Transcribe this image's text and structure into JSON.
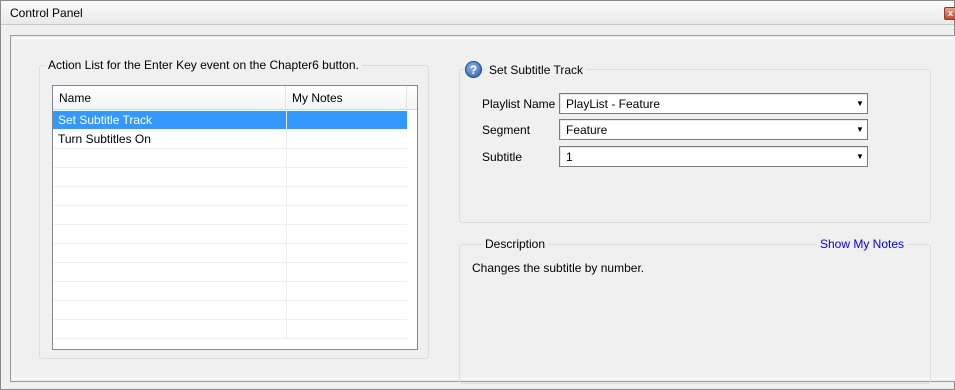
{
  "window": {
    "title": "Control Panel",
    "close_glyph": "x"
  },
  "action_list": {
    "legend": "Action List for the Enter Key event on the Chapter6 button.",
    "columns": {
      "name": "Name",
      "notes": "My Notes"
    },
    "rows": [
      {
        "name": "Set Subtitle Track",
        "notes": "",
        "selected": true
      },
      {
        "name": "Turn Subtitles On",
        "notes": "",
        "selected": false
      }
    ]
  },
  "properties": {
    "title": "Set Subtitle Track",
    "help_glyph": "?",
    "playlist": {
      "label": "Playlist Name",
      "value": "PlayList - Feature"
    },
    "segment": {
      "label": "Segment",
      "value": "Feature"
    },
    "subtitle": {
      "label": "Subtitle",
      "value": "1"
    },
    "dropdown_glyph": "▼"
  },
  "description": {
    "legend": "Description",
    "show_notes_link": "Show My Notes",
    "text": "Changes the subtitle by number."
  },
  "colors": {
    "selection": "#3399ff",
    "link": "#0000ee",
    "window_bg": "#f0f0f0"
  }
}
